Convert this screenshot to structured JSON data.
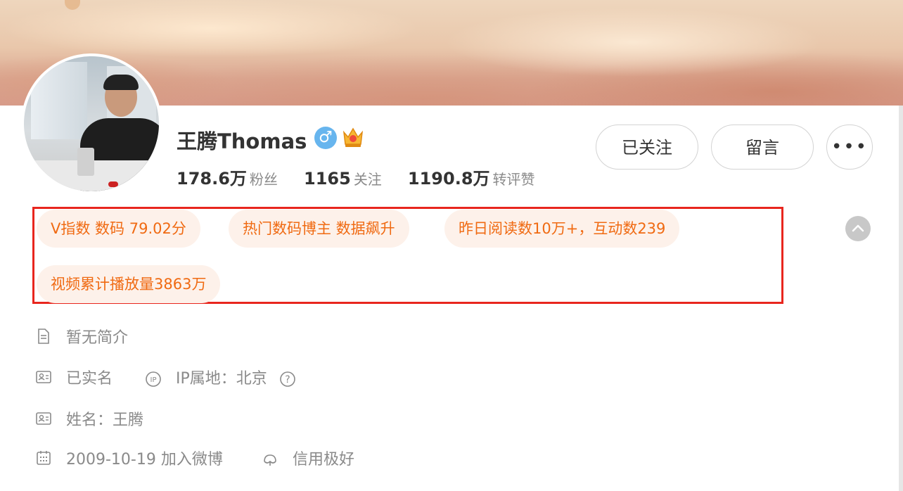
{
  "profile": {
    "name": "王腾Thomas",
    "gender_icon": "male-icon",
    "badge_icon": "crown-icon",
    "stats": [
      {
        "num": "178.6万",
        "label": "粉丝"
      },
      {
        "num": "1165",
        "label": "关注"
      },
      {
        "num": "1190.8万",
        "label": "转评赞"
      }
    ]
  },
  "actions": {
    "follow_label": "已关注",
    "message_label": "留言",
    "more_label": "•••"
  },
  "tags": [
    "V指数 数码 79.02分",
    "热门数码博主 数据飙升",
    "昨日阅读数10万+，互动数239",
    "视频累计播放量3863万"
  ],
  "info": {
    "bio": "暂无简介",
    "verified": "已实名",
    "ip": "IP属地：北京",
    "realname": "姓名：王腾",
    "joined": "2009-10-19 加入微博",
    "credit": "信用极好"
  },
  "colors": {
    "tag_text": "#f06a12",
    "tag_bg": "#fdf1ea",
    "highlight_border": "#e8261e",
    "gender_badge": "#67b5ee"
  }
}
